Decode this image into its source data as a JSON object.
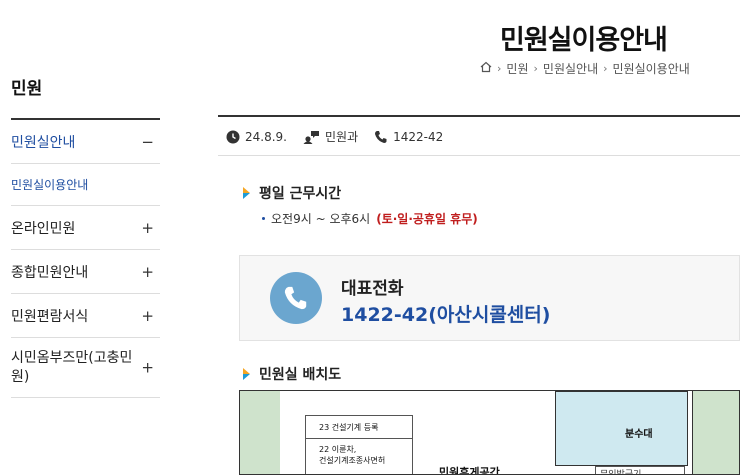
{
  "header": {
    "title": "민원실이용안내",
    "breadcrumb": [
      "민원",
      "민원실안내",
      "민원실이용안내"
    ]
  },
  "sidebar": {
    "title": "민원",
    "items": [
      {
        "label": "민원실안내",
        "toggle": "−"
      },
      {
        "label": "민원실이용안내"
      },
      {
        "label": "온라인민원",
        "toggle": "+"
      },
      {
        "label": "종합민원안내",
        "toggle": "+"
      },
      {
        "label": "민원편람서식",
        "toggle": "+"
      },
      {
        "label": "시민옴부즈만(고충민원)",
        "toggle": "+"
      }
    ]
  },
  "meta": {
    "date": "24.8.9.",
    "department": "민원과",
    "phone": "1422-42"
  },
  "hours": {
    "title": "평일 근무시간",
    "text": "오전9시 ~ 오후6시",
    "closed": "(토·일·공휴일 휴무)"
  },
  "phone_box": {
    "label": "대표전화",
    "number": "1422-42(아산시콜센터)"
  },
  "floormap": {
    "title": "민원실 배치도",
    "room_water": "분수대",
    "box1": "23 건설기계 등록",
    "box2_line1": "22 이륜차,",
    "box2_line2": "건설기계조종사면허",
    "hall": "민원휴게공간",
    "small": "무인발급기"
  },
  "colors": {
    "accent_blue": "#1f4ea1",
    "closed_red": "#c01e1e",
    "phone_circle": "#6ba6cf",
    "arrow_orange": "#f5a623",
    "arrow_teal": "#1e9bd7"
  }
}
